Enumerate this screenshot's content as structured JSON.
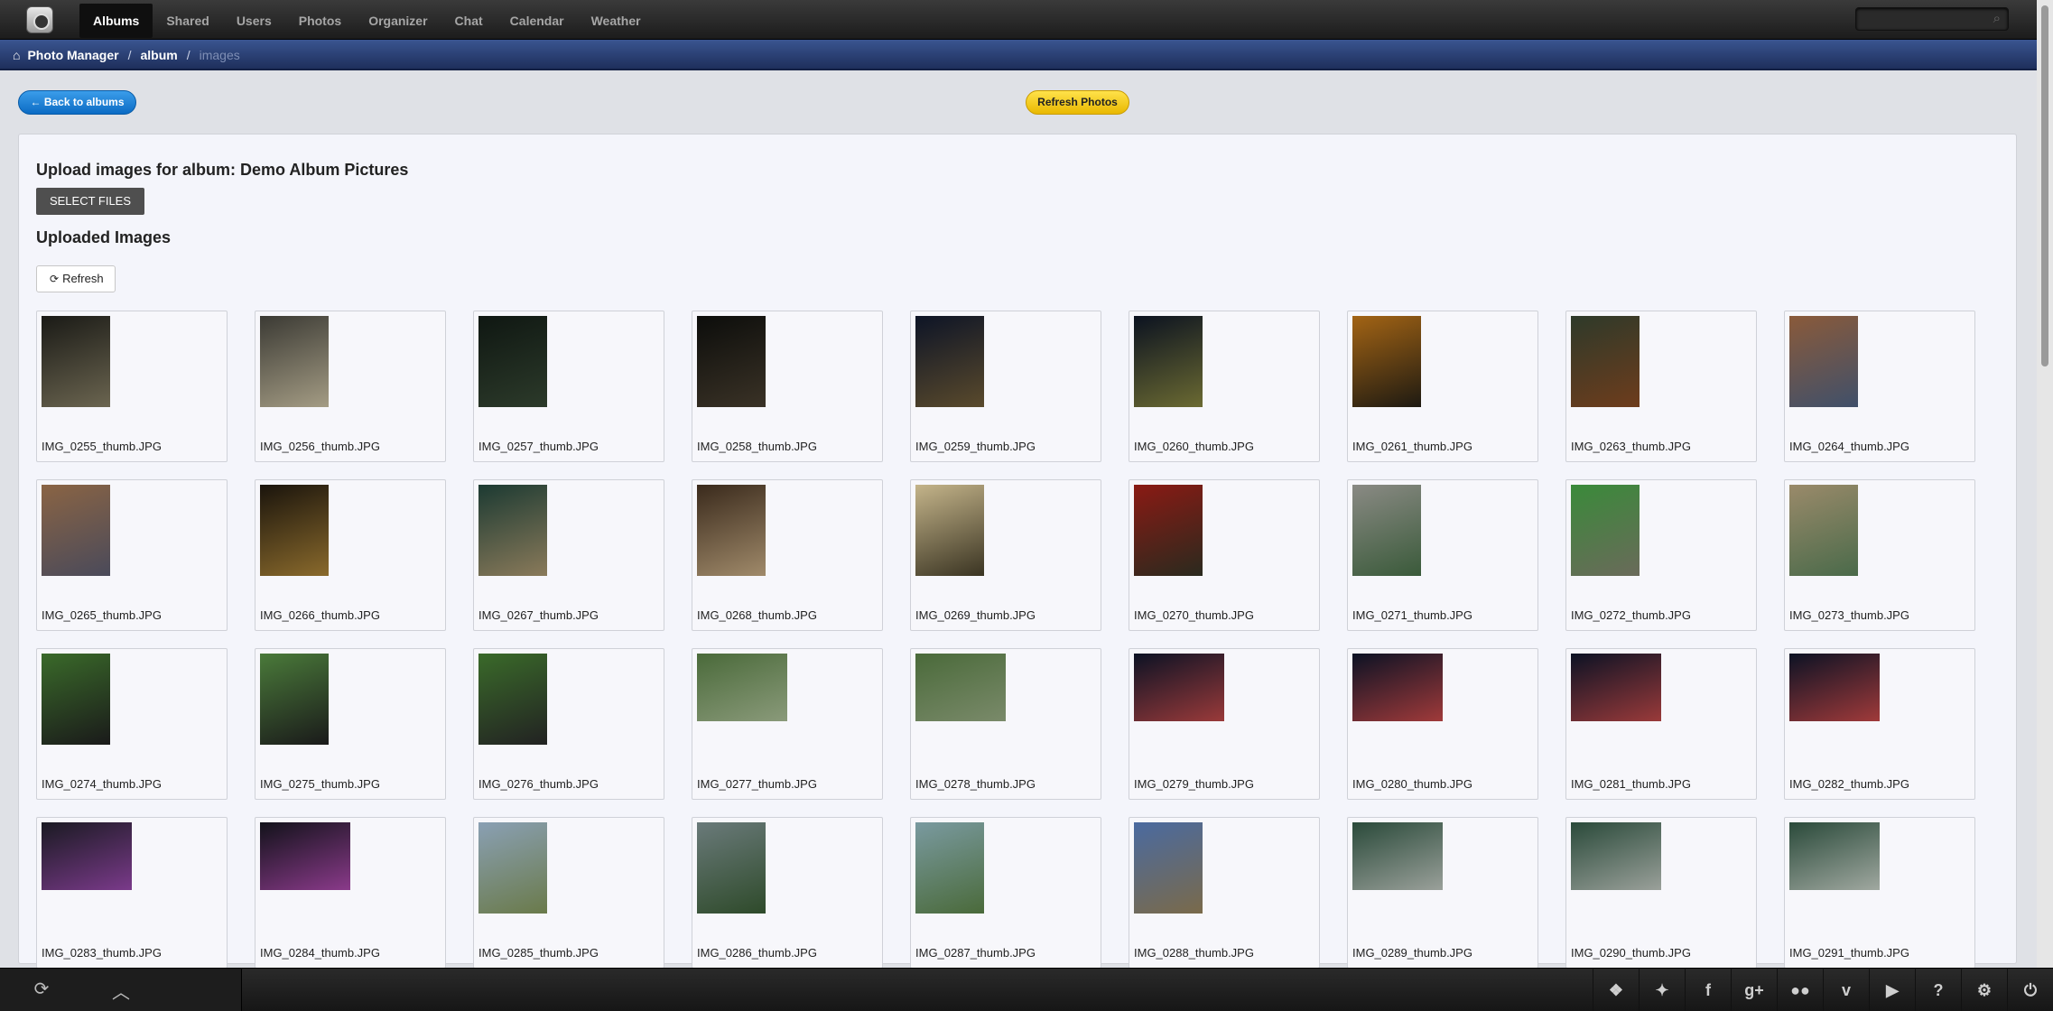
{
  "nav": {
    "items": [
      {
        "label": "Albums",
        "active": true
      },
      {
        "label": "Shared",
        "active": false
      },
      {
        "label": "Users",
        "active": false
      },
      {
        "label": "Photos",
        "active": false
      },
      {
        "label": "Organizer",
        "active": false
      },
      {
        "label": "Chat",
        "active": false
      },
      {
        "label": "Calendar",
        "active": false
      },
      {
        "label": "Weather",
        "active": false
      }
    ],
    "search_icon": "search-icon"
  },
  "breadcrumb": {
    "home": "Photo Manager",
    "album": "album",
    "current": "images"
  },
  "actions": {
    "back": "← Back to albums",
    "refresh_photos": "Refresh Photos"
  },
  "upload": {
    "title": "Upload images for album: Demo Album Pictures",
    "select_files": "SELECT FILES",
    "uploaded_title": "Uploaded Images",
    "refresh": "Refresh"
  },
  "images": [
    {
      "name": "IMG_0255_thumb.JPG",
      "orient": "portrait",
      "colors": [
        "#1a1a16",
        "#6b6550"
      ]
    },
    {
      "name": "IMG_0256_thumb.JPG",
      "orient": "portrait",
      "colors": [
        "#3b3a34",
        "#a49c84"
      ]
    },
    {
      "name": "IMG_0257_thumb.JPG",
      "orient": "portrait",
      "colors": [
        "#0f1712",
        "#2c3a2a"
      ]
    },
    {
      "name": "IMG_0258_thumb.JPG",
      "orient": "portrait",
      "colors": [
        "#0c0d0b",
        "#3a3226"
      ]
    },
    {
      "name": "IMG_0259_thumb.JPG",
      "orient": "portrait",
      "colors": [
        "#0d1426",
        "#5a4a2c"
      ]
    },
    {
      "name": "IMG_0260_thumb.JPG",
      "orient": "portrait",
      "colors": [
        "#0b1220",
        "#6b6a32"
      ]
    },
    {
      "name": "IMG_0261_thumb.JPG",
      "orient": "portrait",
      "colors": [
        "#a36414",
        "#1e1a12"
      ]
    },
    {
      "name": "IMG_0263_thumb.JPG",
      "orient": "portrait",
      "colors": [
        "#2e3a2a",
        "#6e3c1c"
      ]
    },
    {
      "name": "IMG_0264_thumb.JPG",
      "orient": "portrait",
      "colors": [
        "#8a5a3a",
        "#40506a"
      ]
    },
    {
      "name": "IMG_0265_thumb.JPG",
      "orient": "portrait",
      "colors": [
        "#8a6444",
        "#4a4a5a"
      ]
    },
    {
      "name": "IMG_0266_thumb.JPG",
      "orient": "portrait",
      "colors": [
        "#1a140c",
        "#8a6a2c"
      ]
    },
    {
      "name": "IMG_0267_thumb.JPG",
      "orient": "portrait",
      "colors": [
        "#1c3a32",
        "#8a7a5a"
      ]
    },
    {
      "name": "IMG_0268_thumb.JPG",
      "orient": "portrait",
      "colors": [
        "#3a2a1c",
        "#a08a6a"
      ]
    },
    {
      "name": "IMG_0269_thumb.JPG",
      "orient": "portrait",
      "colors": [
        "#c4b48a",
        "#3a3422"
      ]
    },
    {
      "name": "IMG_0270_thumb.JPG",
      "orient": "portrait",
      "colors": [
        "#8a1a14",
        "#2a2a1e"
      ]
    },
    {
      "name": "IMG_0271_thumb.JPG",
      "orient": "portrait",
      "colors": [
        "#8a8a84",
        "#3a5a3a"
      ]
    },
    {
      "name": "IMG_0272_thumb.JPG",
      "orient": "portrait",
      "colors": [
        "#3a8a3a",
        "#6a6a5a"
      ]
    },
    {
      "name": "IMG_0273_thumb.JPG",
      "orient": "portrait",
      "colors": [
        "#9a8a6a",
        "#4a6a4a"
      ]
    },
    {
      "name": "IMG_0274_thumb.JPG",
      "orient": "portrait",
      "colors": [
        "#3a6a2a",
        "#1a1a1a"
      ]
    },
    {
      "name": "IMG_0275_thumb.JPG",
      "orient": "portrait",
      "colors": [
        "#4a7a3a",
        "#1a1a1a"
      ]
    },
    {
      "name": "IMG_0276_thumb.JPG",
      "orient": "portrait",
      "colors": [
        "#3a6a2a",
        "#222222"
      ]
    },
    {
      "name": "IMG_0277_thumb.JPG",
      "orient": "landscape",
      "colors": [
        "#4a6a3a",
        "#8a9a7a"
      ]
    },
    {
      "name": "IMG_0278_thumb.JPG",
      "orient": "landscape",
      "colors": [
        "#4a6a3a",
        "#7a8a6a"
      ]
    },
    {
      "name": "IMG_0279_thumb.JPG",
      "orient": "landscape",
      "colors": [
        "#0c1224",
        "#9a3a3a"
      ]
    },
    {
      "name": "IMG_0280_thumb.JPG",
      "orient": "landscape",
      "colors": [
        "#0c1224",
        "#a03a3a"
      ]
    },
    {
      "name": "IMG_0281_thumb.JPG",
      "orient": "landscape",
      "colors": [
        "#0c1224",
        "#9a3a3a"
      ]
    },
    {
      "name": "IMG_0282_thumb.JPG",
      "orient": "landscape",
      "colors": [
        "#0c1224",
        "#a03a3a"
      ]
    },
    {
      "name": "IMG_0283_thumb.JPG",
      "orient": "landscape",
      "colors": [
        "#1a1a22",
        "#7a3a8a"
      ]
    },
    {
      "name": "IMG_0284_thumb.JPG",
      "orient": "landscape",
      "colors": [
        "#12121a",
        "#8a3a8a"
      ]
    },
    {
      "name": "IMG_0285_thumb.JPG",
      "orient": "portrait",
      "colors": [
        "#8aa0b4",
        "#6a7a4a"
      ]
    },
    {
      "name": "IMG_0286_thumb.JPG",
      "orient": "portrait",
      "colors": [
        "#6a7a7a",
        "#2e4a2a"
      ]
    },
    {
      "name": "IMG_0287_thumb.JPG",
      "orient": "portrait",
      "colors": [
        "#7a9aa0",
        "#4a6a3a"
      ]
    },
    {
      "name": "IMG_0288_thumb.JPG",
      "orient": "portrait",
      "colors": [
        "#4a6aa0",
        "#7a6a4a"
      ]
    },
    {
      "name": "IMG_0289_thumb.JPG",
      "orient": "landscape",
      "colors": [
        "#2a4a3a",
        "#9aa09a"
      ]
    },
    {
      "name": "IMG_0290_thumb.JPG",
      "orient": "landscape",
      "colors": [
        "#2a4a3a",
        "#9aa09a"
      ]
    },
    {
      "name": "IMG_0291_thumb.JPG",
      "orient": "landscape",
      "colors": [
        "#2a4a3a",
        "#a0a8a0"
      ]
    }
  ],
  "bottom": {
    "left_icons": [
      "refresh-icon",
      "chevron-up-icon"
    ],
    "right_icons": [
      {
        "name": "dropbox-icon",
        "glyph": "❖"
      },
      {
        "name": "twitter-icon",
        "glyph": "✦"
      },
      {
        "name": "facebook-icon",
        "glyph": "f"
      },
      {
        "name": "google-plus-icon",
        "glyph": "g+"
      },
      {
        "name": "flickr-icon",
        "glyph": "●●"
      },
      {
        "name": "vimeo-icon",
        "glyph": "v"
      },
      {
        "name": "youtube-icon",
        "glyph": "▶"
      },
      {
        "name": "help-icon",
        "glyph": "?"
      },
      {
        "name": "settings-icon",
        "glyph": "⚙"
      },
      {
        "name": "logout-icon",
        "glyph": "⏻"
      }
    ]
  }
}
